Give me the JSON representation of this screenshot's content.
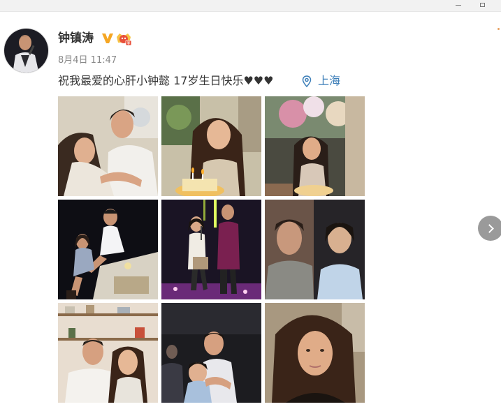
{
  "post": {
    "username": "钟镇涛",
    "timestamp": "8月4日 11:47",
    "text": "祝我最爱的心肝小钟懿 17岁生日快乐♥♥♥",
    "location": "上海"
  },
  "colors": {
    "link": "#3c7eb8",
    "verified_badge": "#f5a623",
    "vip_badge": "#e8503a",
    "next_button": "#9a9a9a"
  },
  "icons": {
    "verified": "verified-v-icon",
    "vip": "vip-crown-icon",
    "location": "location-pin-icon",
    "next": "chevron-right-icon"
  },
  "photos": [
    {
      "subject": "father-daughter-hug"
    },
    {
      "subject": "girl-with-birthday-cake"
    },
    {
      "subject": "girl-at-table-with-cake"
    },
    {
      "subject": "duo-on-stage-steps"
    },
    {
      "subject": "duo-singing-on-stage"
    },
    {
      "subject": "old-and-young-portraits"
    },
    {
      "subject": "duo-in-kitchen"
    },
    {
      "subject": "father-hugging-child"
    },
    {
      "subject": "girl-selfie"
    }
  ]
}
